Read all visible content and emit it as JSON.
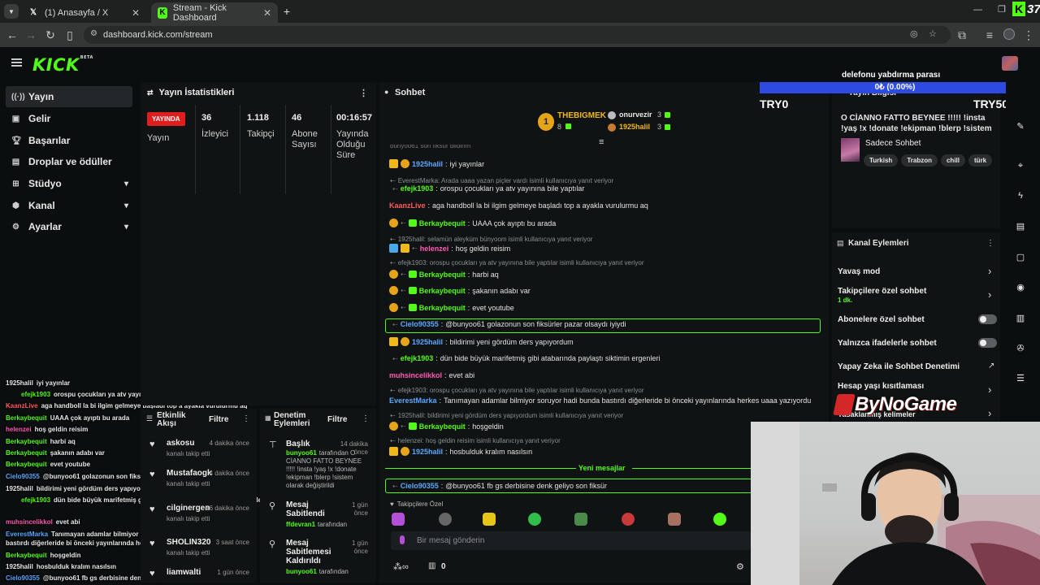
{
  "browser": {
    "tabs": [
      {
        "title": "(1) Anasayfa / X",
        "icon": "x-icon"
      },
      {
        "title": "Stream - Kick Dashboard",
        "icon": "kick-icon"
      }
    ],
    "url": "dashboard.kick.com/stream",
    "corner_text": "37"
  },
  "header": {
    "logo": "KICK",
    "logo_badge": "BETA"
  },
  "sidebar": {
    "items": [
      {
        "label": "Yayın",
        "icon": "broadcast-icon"
      },
      {
        "label": "Gelir",
        "icon": "wallet-icon"
      },
      {
        "label": "Başarılar",
        "icon": "trophy-icon"
      },
      {
        "label": "Droplar ve ödüller",
        "icon": "gift-icon"
      },
      {
        "label": "Stüdyo",
        "icon": "studio-icon"
      },
      {
        "label": "Kanal",
        "icon": "channel-icon"
      },
      {
        "label": "Ayarlar",
        "icon": "settings-icon"
      }
    ]
  },
  "stats": {
    "title": "Yayın İstatistikleri",
    "live_badge": "YAYINDA",
    "status_label": "Yayın",
    "viewers_value": "36",
    "viewers_label": "İzleyici",
    "followers_value": "1.118",
    "followers_label": "Takipçi",
    "subs_value": "46",
    "subs_label": "Abone Sayısı",
    "uptime_value": "00:16:57",
    "uptime_label": "Yayında Olduğu Süre"
  },
  "overlay_chat": [
    {
      "user": "1925halil",
      "text": "iyi yayınlar",
      "color": "#e8e8e8"
    },
    {
      "user": "efejk1903",
      "text": "orospu çocukları ya atv yayınına bile yaptılar",
      "color": "#53fc18"
    },
    {
      "user": "KaanzLive",
      "text": "aga handboll la bi ilgim gelmeye başladı top a ayakla vurulurmu aq",
      "color": "#ff5a5a"
    },
    {
      "user": "Berkaybequit",
      "text": "UAAA çok ayıptı bu arada",
      "color": "#53fc18"
    },
    {
      "user": "helenzei",
      "text": "hoş geldin reisim",
      "color": "#ff5ab4"
    },
    {
      "user": "Berkaybequit",
      "text": "harbi aq",
      "color": "#53fc18"
    },
    {
      "user": "Berkaybequit",
      "text": "şakanın adabı var",
      "color": "#53fc18"
    },
    {
      "user": "Berkaybequit",
      "text": "evet youtube",
      "color": "#53fc18"
    },
    {
      "user": "Cielo90355",
      "text": "@bunyoo61 golazonun son fiksürler pazar olsaydı iyiydi",
      "color": "#5aa8ff"
    },
    {
      "user": "1925halil",
      "text": "bildirimi yeni gördüm ders yapıyordum",
      "color": "#e8e8e8"
    },
    {
      "user": "efejk1903",
      "text": "dün bide büyük marifetmiş gibi atabarında paylaştı siktimin ergenleri",
      "color": "#53fc18"
    },
    {
      "user": "muhsincelikkol",
      "text": "evet abi",
      "color": "#ff5ab4"
    },
    {
      "user": "EverestMarka",
      "text": "Tanımayan adamlar bilmiyor soruyor hadi bunda bastırdı diğerleride bi önceki yayınlarında herkes uaaa yazıyordu",
      "color": "#5aa8ff"
    },
    {
      "user": "Berkaybequit",
      "text": "hoşgeldin",
      "color": "#53fc18"
    },
    {
      "user": "1925halil",
      "text": "hosbulduk kralım nasılsın",
      "color": "#e8e8e8"
    },
    {
      "user": "Cielo90355",
      "text": "@bunyoo61 fb gs derbisine denk geliyo son fiksür",
      "color": "#5aa8ff"
    }
  ],
  "activity": {
    "title": "Etkinlik Akışı",
    "filter": "Filtre",
    "items": [
      {
        "user": "askosu",
        "action": "kanalı takip etti",
        "time": "4 dakika önce"
      },
      {
        "user": "Mustafaogk",
        "action": "kanalı takip etti",
        "time": "4 dakika önce"
      },
      {
        "user": "cilginergen",
        "action": "kanalı takip etti",
        "time": "16 dakika önce"
      },
      {
        "user": "SHOLIN320",
        "action": "kanalı takip etti",
        "time": "3 saat önce"
      },
      {
        "user": "liamwalti",
        "action": "",
        "time": "1 gün önce"
      }
    ]
  },
  "moderation": {
    "title": "Denetim Eylemleri",
    "filter": "Filtre",
    "items": [
      {
        "title": "Başlık",
        "user": "bunyoo61",
        "detail": "tarafından O CİANNO FATTO BEYNEE !!!!! !insta !yaş !x !donate !ekipman !blerp !sistem olarak değiştirildi",
        "time": "14 dakika önce"
      },
      {
        "title": "Mesaj Sabitlendi",
        "user": "ffdevran1",
        "detail": "tarafından",
        "time": "1 gün önce"
      },
      {
        "title": "Mesaj Sabitlemesi Kaldırıldı",
        "user": "bunyoo61",
        "detail": "tarafından",
        "time": "1 gün önce"
      }
    ]
  },
  "chat": {
    "title": "Sohbet",
    "top_user": "THEBIGMEK",
    "top_count": "8",
    "rank2_user": "onurvezir",
    "rank2_count": "3",
    "rank3_user": "1925halil",
    "rank3_count": "3",
    "partial_line": "bunyoo61 son fiksür bildirim",
    "messages": [
      {
        "type": "msg",
        "user": "1925halil",
        "text": "iyi yayınlar",
        "color": "#5aa8ff",
        "badges": [
          "crown",
          "or"
        ]
      },
      {
        "type": "reply",
        "text": "EverestMarka: Arada uaaa yazan piçler vardı isimli kullanıcıya yanıt veriyor"
      },
      {
        "type": "msg",
        "user": "efejk1903",
        "text": "orospu çocukları ya atv yayınına bile yaptılar",
        "color": "#53fc18",
        "badges": [
          "reply"
        ]
      },
      {
        "type": "msg",
        "user": "KaanzLive",
        "text": "aga handboll la bi ilgim gelmeye başladı top a ayakla vurulurmu aq",
        "color": "#ff5a5a",
        "badges": []
      },
      {
        "type": "msg",
        "user": "Berkaybequit",
        "text": "UAAA çok ayıptı bu arada",
        "color": "#53fc18",
        "badges": [
          "or",
          "mod",
          "sub"
        ]
      },
      {
        "type": "reply",
        "text": "1925halil: selamün aleyküm bünyoom isimli kullanıcıya yanıt veriyor"
      },
      {
        "type": "msg",
        "user": "helenzei",
        "text": "hoş geldin reisim",
        "color": "#ff5ab4",
        "badges": [
          "gr",
          "crown",
          "mod"
        ]
      },
      {
        "type": "reply",
        "text": "efejk1903: orospu çocukları ya atv yayınına bile yaptılar isimli kullanıcıya yanıt veriyor"
      },
      {
        "type": "msg",
        "user": "Berkaybequit",
        "text": "harbi aq",
        "color": "#53fc18",
        "badges": [
          "or",
          "mod",
          "sub"
        ]
      },
      {
        "type": "msg",
        "user": "Berkaybequit",
        "text": "şakanın adabı var",
        "color": "#53fc18",
        "badges": [
          "or",
          "mod",
          "sub"
        ]
      },
      {
        "type": "msg",
        "user": "Berkaybequit",
        "text": "evet youtube",
        "color": "#53fc18",
        "badges": [
          "or",
          "mod",
          "sub"
        ]
      },
      {
        "type": "highlight",
        "user": "Cielo90355",
        "text": "@bunyoo61 golazonun son fiksürler pazar olsaydı iyiydi",
        "color": "#5aa8ff",
        "badges": [
          "mod"
        ]
      },
      {
        "type": "msg",
        "user": "1925halil",
        "text": "bildirimi yeni gördüm ders yapıyordum",
        "color": "#5aa8ff",
        "badges": [
          "crown",
          "or"
        ]
      },
      {
        "type": "msg",
        "user": "efejk1903",
        "text": "dün bide büyük marifetmiş gibi atabarında paylaştı siktimin ergenleri",
        "color": "#53fc18",
        "badges": [
          "reply"
        ]
      },
      {
        "type": "msg",
        "user": "muhsincelikkol",
        "text": "evet abi",
        "color": "#ff5ab4",
        "badges": []
      },
      {
        "type": "reply",
        "text": "efejk1903: orospu çocukları ya atv yayınına bile yaptılar isimli kullanıcıya yanıt veriyor"
      },
      {
        "type": "msg",
        "user": "EverestMarka",
        "text": "Tanımayan adamlar bilmiyor soruyor hadi bunda bastırdı diğerleride bi önceki yayınlarında herkes uaaa yazıyordu",
        "color": "#5aa8ff",
        "badges": []
      },
      {
        "type": "reply",
        "text": "1925halil: bildirimi yeni gördüm ders yapıyordum isimli kullanıcıya yanıt veriyor"
      },
      {
        "type": "msg",
        "user": "Berkaybequit",
        "text": "hoşgeldin",
        "color": "#53fc18",
        "badges": [
          "or",
          "mod",
          "sub"
        ]
      },
      {
        "type": "reply",
        "text": "helenzei: hoş geldin reisim isimli kullanıcıya yanıt veriyor"
      },
      {
        "type": "msg",
        "user": "1925halil",
        "text": "hosbulduk kralım nasılsın",
        "color": "#5aa8ff",
        "badges": [
          "crown",
          "or"
        ]
      }
    ],
    "new_messages": "Yeni mesajlar",
    "last_msg_user": "Cielo90355",
    "last_msg_text": "@bunyoo61 fb gs derbisine denk geliyo son fiksür",
    "followers_only": "Takipçilere Özel",
    "input_placeholder": "Bir mesaj gönderin",
    "footer_count": "0"
  },
  "overlay": {
    "title": "delefonu yabdırma parası",
    "progress_text": "0₺ (0.00%)",
    "progress_fraction": 0.0,
    "left": "TRY0",
    "right": "TRY5000",
    "brand": "ByNoGame"
  },
  "stream_info": {
    "header": "Yayın Bilgisi",
    "title": "O CİANNO FATTO BEYNEE !!!!! !insta !yaş !x !donate !ekipman !blerp !sistem",
    "category": "Sadece Sohbet",
    "tags": [
      "Turkish",
      "Trabzon",
      "chill",
      "türk"
    ]
  },
  "channel_actions": {
    "title": "Kanal Eylemleri",
    "slow_mode": "Yavaş mod",
    "followers_chat": "Takipçilere özel sohbet",
    "followers_chat_value": "1 dk.",
    "subs_chat": "Abonelere özel sohbet",
    "emotes_chat": "Yalnızca ifadelerle sohbet",
    "ai_mod": "Yapay Zeka ile Sohbet Denetimi",
    "age_limits": "Hesap yaşı kısıtlaması",
    "banned_words": "Yasaklanmış kelimeler"
  }
}
